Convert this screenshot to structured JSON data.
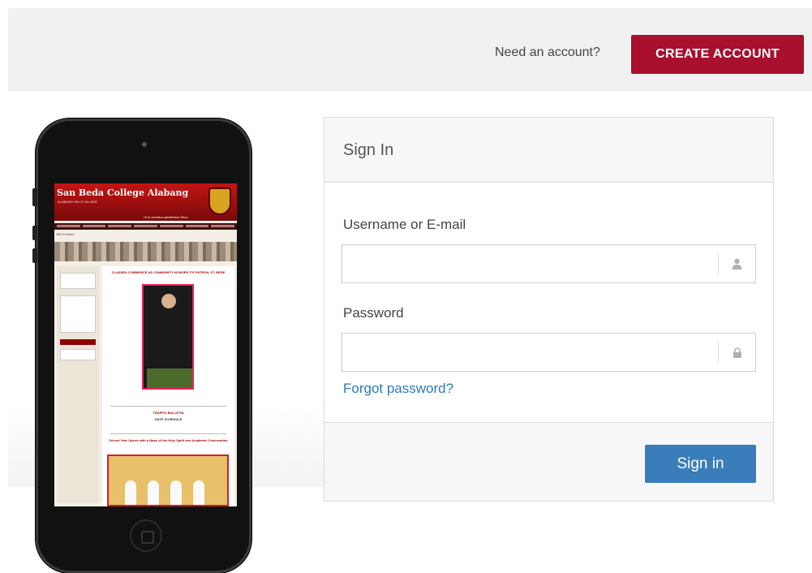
{
  "header": {
    "prompt": "Need an account?",
    "create_label": "CREATE ACCOUNT"
  },
  "phone_screen": {
    "site_title": "San Beda College Alabang",
    "site_subtitle": "ALABANG HILLS VILLAGE",
    "motto": "Ut in omnibus glorificetur Deus",
    "breadcrumb": "SBCA Home",
    "headline1": "CLASSES COMMENCE AS COMMUNITY HONORS ITS PATRON, ST. BEDE",
    "headline2": "TRAFFIC BULLETIN",
    "headline2_sub": "GATE SCHEDULE",
    "headline3": "School Year Opens with a Mass of the Holy Spirit and Academic Convocation"
  },
  "signin": {
    "title": "Sign In",
    "username_label": "Username or E-mail",
    "username_value": "",
    "password_label": "Password",
    "password_value": "",
    "forgot_label": "Forgot password?",
    "submit_label": "Sign in",
    "username_icon": "user-icon",
    "password_icon": "lock-icon"
  },
  "colors": {
    "accent_red": "#a8102e",
    "primary_blue": "#3a7dbb",
    "link_blue": "#2e7bb6"
  }
}
